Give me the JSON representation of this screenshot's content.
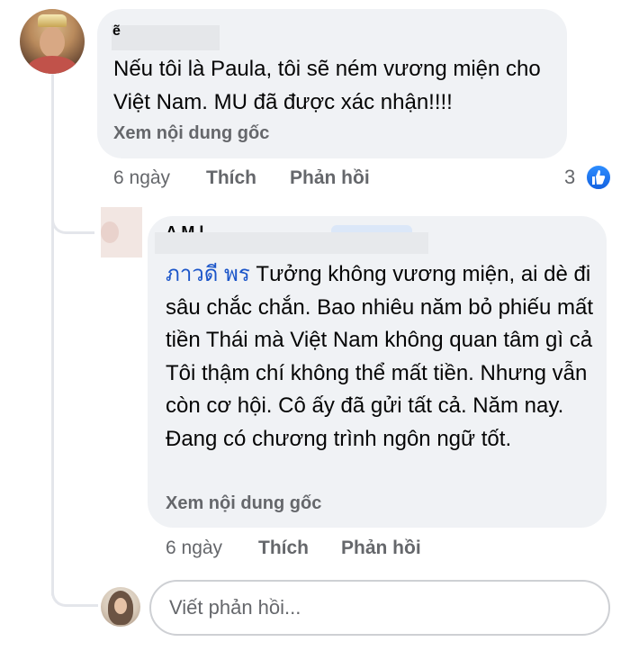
{
  "comment": {
    "author_initial": "ẽ",
    "text": "Nếu tôi là Paula, tôi sẽ ném vương miện cho Việt Nam. MU đã được xác nhận!!!!",
    "see_original": "Xem nội dung gốc",
    "time": "6 ngày",
    "like": "Thích",
    "reply": "Phản hồi",
    "reaction_count": "3",
    "reaction_icon": "like-thumb-icon"
  },
  "reply_comment": {
    "author_partial": "A      M      l",
    "tag": "ภาวดี พร",
    "text": " Tưởng không vương miện, ai dè đi sâu chắc chắn. Bao nhiêu năm bỏ phiếu mất tiền Thái mà Việt Nam không quan tâm gì cả Tôi thậm chí không thể mất tiền. Nhưng vẫn còn cơ hội. Cô ấy đã gửi tất cả. Năm nay. Đang có chương trình ngôn ngữ tốt.",
    "see_original": "Xem nội dung gốc",
    "time": "6 ngày",
    "like": "Thích",
    "reply": "Phản hồi"
  },
  "reply_input": {
    "placeholder": "Viết phản hồi..."
  },
  "colors": {
    "bubble": "#f0f2f5",
    "meta_text": "#65676b",
    "tag_link": "#1b55c9",
    "like_blue": "#1877f2"
  }
}
